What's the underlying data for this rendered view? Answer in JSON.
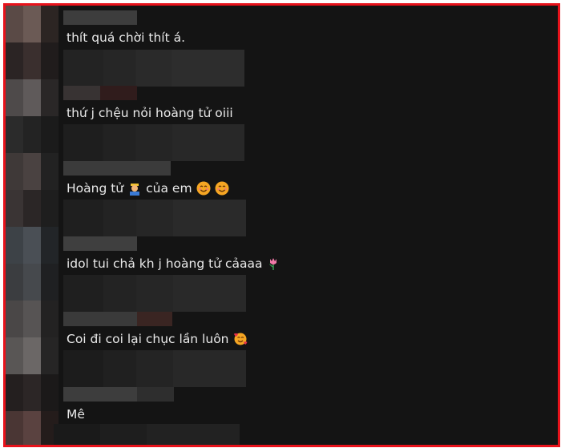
{
  "comments": [
    {
      "text": "thít quá chời thít á.",
      "emojis": []
    },
    {
      "text": "thứ j chệu nỏi hoàng tử oiii",
      "emojis": []
    },
    {
      "text": "Hoàng tử",
      "emojis": [
        "prince-emoji"
      ],
      "text_after": "của em",
      "emojis_after": [
        "smiling-face-emoji",
        "smiling-face-emoji"
      ]
    },
    {
      "text": "idol tui chả kh j hoàng tử cảaaa",
      "emojis": [
        "tulip-emoji"
      ]
    },
    {
      "text": "Coi đi coi lại chục lần luôn",
      "emojis": [
        "smiling-face-with-hearts-emoji"
      ]
    },
    {
      "text": "Mê",
      "emojis": []
    }
  ],
  "colors": {
    "frame_border": "#e8121b",
    "background": "#141414",
    "text": "#e9e9e9"
  }
}
